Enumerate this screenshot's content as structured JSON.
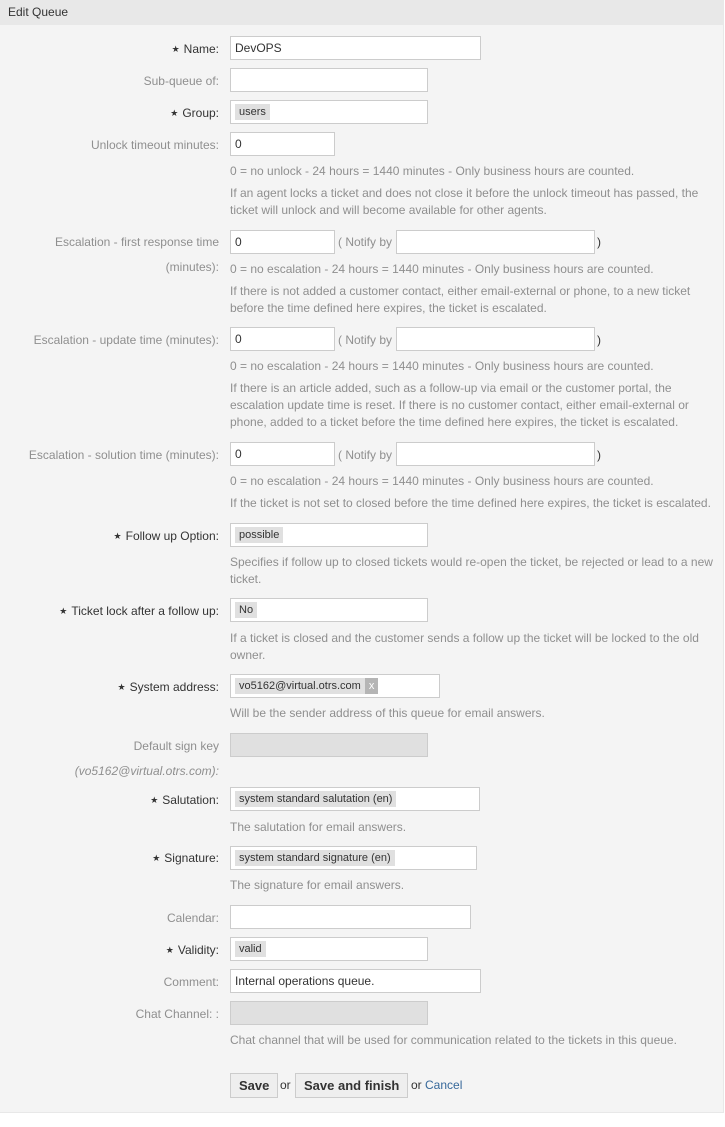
{
  "header": {
    "title": "Edit Queue"
  },
  "fields": {
    "name": {
      "label": "Name:",
      "value": "DevOPS"
    },
    "subqueue": {
      "label": "Sub-queue of:",
      "value": ""
    },
    "group": {
      "label": "Group:",
      "value": "users"
    },
    "unlock": {
      "label": "Unlock timeout minutes:",
      "value": "0",
      "hint": "0 = no unlock - 24 hours = 1440 minutes - Only business hours are counted.",
      "desc": "If an agent locks a ticket and does not close it before the unlock timeout has passed, the ticket will unlock and will become available for other agents."
    },
    "first_response": {
      "label_line1": "Escalation - first response time",
      "label_line2": "(minutes):",
      "value": "0",
      "notify_label": "( Notify by",
      "notify_value": "",
      "close_paren": ")",
      "hint": "0 = no escalation - 24 hours = 1440 minutes - Only business hours are counted.",
      "desc": "If there is not added a customer contact, either email-external or phone, to a new ticket before the time defined here expires, the ticket is escalated."
    },
    "update_time": {
      "label": "Escalation - update time (minutes):",
      "value": "0",
      "notify_label": "( Notify by",
      "notify_value": "",
      "close_paren": ")",
      "hint": "0 = no escalation - 24 hours = 1440 minutes - Only business hours are counted.",
      "desc": "If there is an article added, such as a follow-up via email or the customer portal, the escalation update time is reset. If there is no customer contact, either email-external or phone, added to a ticket before the time defined here expires, the ticket is escalated."
    },
    "solution_time": {
      "label": "Escalation - solution time (minutes):",
      "value": "0",
      "notify_label": "( Notify by",
      "notify_value": "",
      "close_paren": ")",
      "hint": "0 = no escalation - 24 hours = 1440 minutes - Only business hours are counted.",
      "desc": "If the ticket is not set to closed before the time defined here expires, the ticket is escalated."
    },
    "follow_up": {
      "label": "Follow up Option:",
      "value": "possible",
      "desc": "Specifies if follow up to closed tickets would re-open the ticket, be rejected or lead to a new ticket."
    },
    "ticket_lock": {
      "label": "Ticket lock after a follow up:",
      "value": "No",
      "desc": "If a ticket is closed and the customer sends a follow up the ticket will be locked to the old owner."
    },
    "system_address": {
      "label": "System address:",
      "value": "vo5162@virtual.otrs.com",
      "remove": "x",
      "desc": "Will be the sender address of this queue for email answers."
    },
    "sign_key": {
      "label_line1": "Default sign key",
      "label_line2": "(vo5162@virtual.otrs.com):",
      "value": ""
    },
    "salutation": {
      "label": "Salutation:",
      "value": "system standard salutation (en)",
      "desc": "The salutation for email answers."
    },
    "signature": {
      "label": "Signature:",
      "value": "system standard signature (en)",
      "desc": "The signature for email answers."
    },
    "calendar": {
      "label": "Calendar:",
      "value": ""
    },
    "validity": {
      "label": "Validity:",
      "value": "valid"
    },
    "comment": {
      "label": "Comment:",
      "value": "Internal operations queue."
    },
    "chat_channel": {
      "label": "Chat Channel: :",
      "value": "",
      "desc": "Chat channel that will be used for communication related to the tickets in this queue."
    }
  },
  "required_marker": "★",
  "actions": {
    "save": "Save",
    "or1": "or",
    "save_finish": "Save and finish",
    "or2": "or",
    "cancel": "Cancel"
  }
}
